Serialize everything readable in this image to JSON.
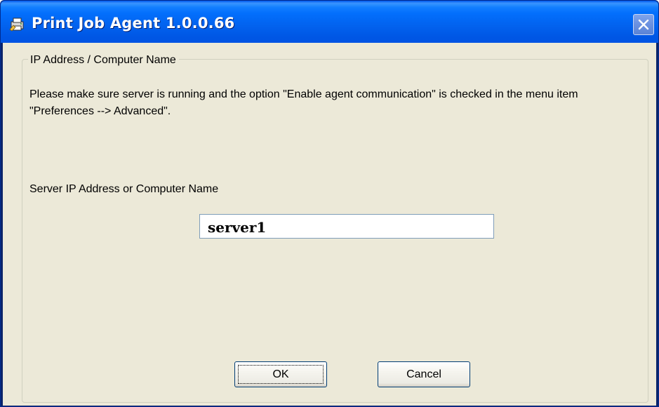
{
  "window": {
    "title": "Print Job Agent 1.0.0.66",
    "icon": "printer-agent-icon",
    "close_icon": "close-icon"
  },
  "group": {
    "legend": "IP Address / Computer Name"
  },
  "message": "Please make sure server is running and the option \"Enable agent communication\" is checked in the menu item \"Preferences --> Advanced\".",
  "server_field": {
    "label": "Server IP Address or Computer Name",
    "value": "server1"
  },
  "buttons": {
    "ok_label": "OK",
    "cancel_label": "Cancel"
  },
  "colors": {
    "titlebar": "#0054e3",
    "client_background": "#ece9d8",
    "button_border": "#003c74"
  }
}
